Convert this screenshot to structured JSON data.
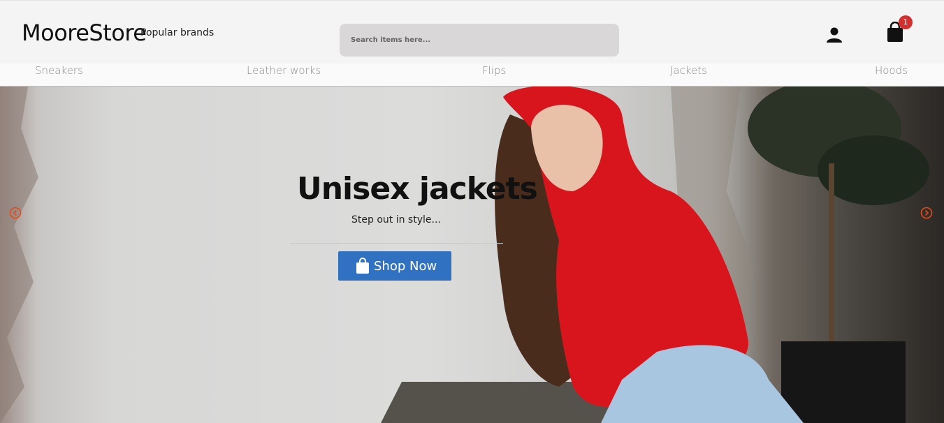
{
  "header": {
    "logo": "MooreStore",
    "popular_label": "Popular brands",
    "search_placeholder": "Search items here...",
    "cart_count": "1"
  },
  "nav": {
    "items": [
      "Sneakers",
      "Leather works",
      "Flips",
      "Jackets",
      "Hoods"
    ]
  },
  "hero": {
    "title": "Unisex jackets",
    "subtitle": "Step out in style...",
    "button_label": "Shop Now",
    "accent_color": "#3171c2",
    "arrow_color": "#e64a19"
  },
  "icons": {
    "user": "user-icon",
    "cart": "shopping-bag-icon",
    "prev": "chevron-left-circle-icon",
    "next": "chevron-right-circle-icon"
  }
}
